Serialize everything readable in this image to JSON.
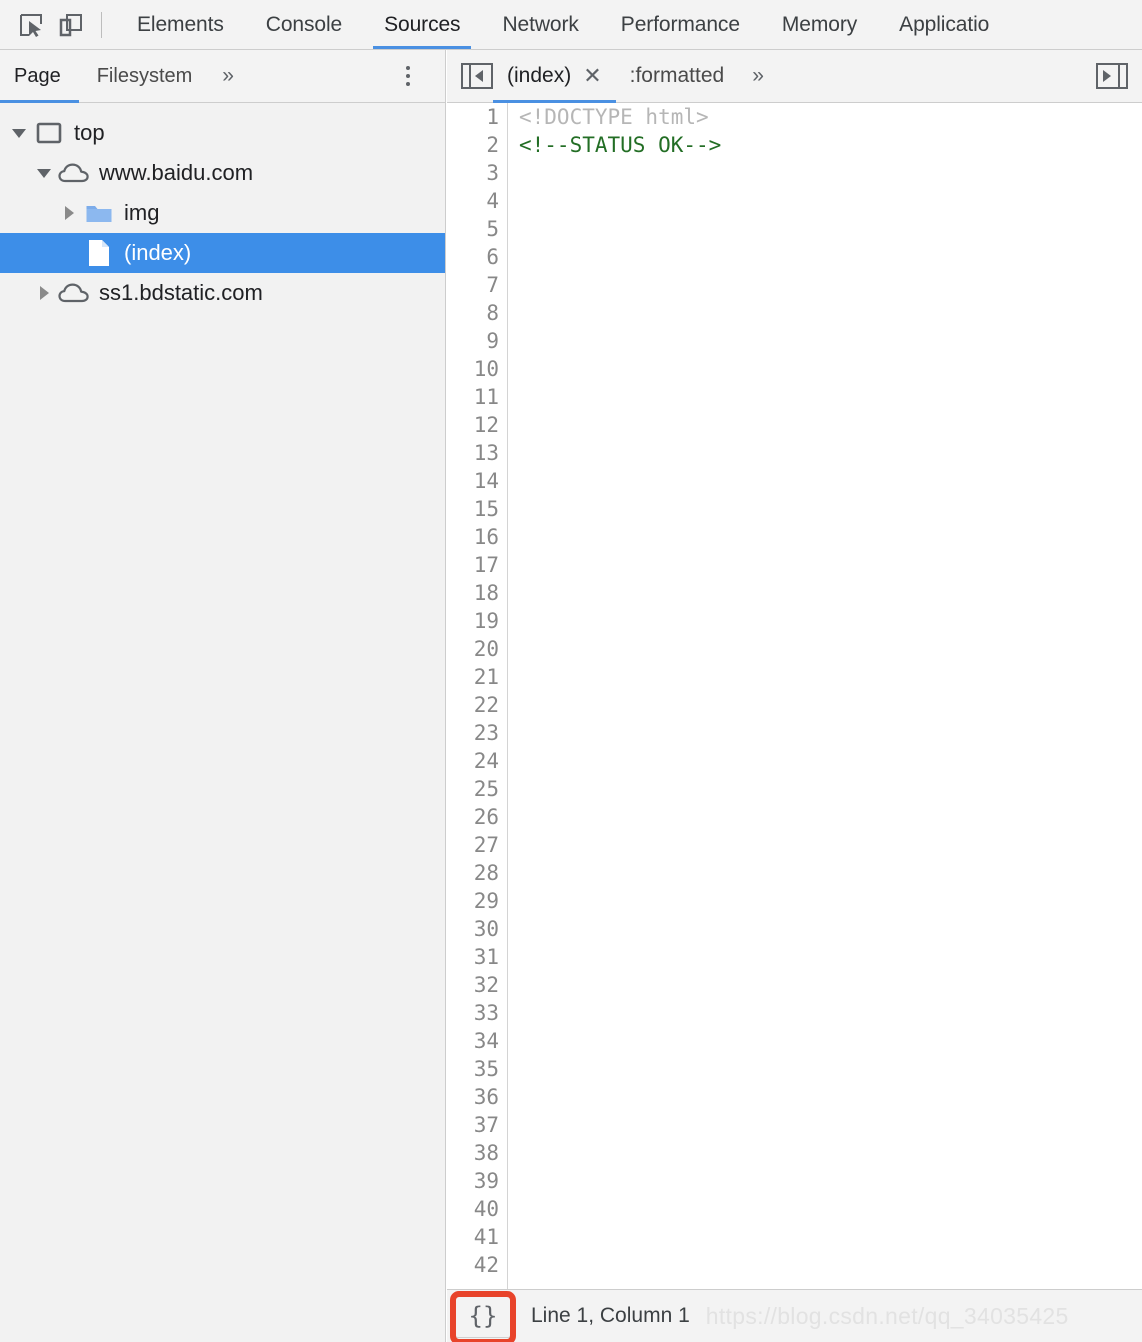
{
  "devtools": {
    "toolbar_icons": [
      {
        "name": "inspect-element-icon",
        "title": "Inspect element"
      },
      {
        "name": "device-toolbar-icon",
        "title": "Toggle device toolbar"
      }
    ],
    "panel_tabs": [
      {
        "label": "Elements",
        "active": false
      },
      {
        "label": "Console",
        "active": false
      },
      {
        "label": "Sources",
        "active": true
      },
      {
        "label": "Network",
        "active": false
      },
      {
        "label": "Performance",
        "active": false
      },
      {
        "label": "Memory",
        "active": false
      },
      {
        "label": "Applicatio",
        "active": false
      }
    ]
  },
  "navigator": {
    "tabs": [
      {
        "label": "Page",
        "active": true
      },
      {
        "label": "Filesystem",
        "active": false
      }
    ],
    "more_label": "»",
    "menu_icon": "kebab-menu-icon",
    "tree": [
      {
        "label": "top",
        "icon": "frame-icon",
        "twisty": "down",
        "depth": 0,
        "selected": false
      },
      {
        "label": "www.baidu.com",
        "icon": "cloud-icon",
        "twisty": "down",
        "depth": 1,
        "selected": false
      },
      {
        "label": "img",
        "icon": "folder-icon",
        "twisty": "right",
        "depth": 2,
        "selected": false
      },
      {
        "label": "(index)",
        "icon": "file-icon",
        "twisty": "none",
        "depth": 2,
        "selected": true
      },
      {
        "label": "ss1.bdstatic.com",
        "icon": "cloud-icon",
        "twisty": "right",
        "depth": 1,
        "selected": false
      }
    ]
  },
  "editor": {
    "toggle_navigator_icon": "collapse-navigator-icon",
    "tabs": [
      {
        "label": "(index)",
        "active": true,
        "closable": true,
        "close_glyph": "✕"
      },
      {
        "label": ":formatted",
        "active": false,
        "closable": false,
        "close_glyph": ""
      }
    ],
    "more_label": "»",
    "drawer_icon": "show-drawer-icon",
    "line_count": 42,
    "code": [
      {
        "line": 1,
        "text": "<!DOCTYPE html>",
        "token": "doctype"
      },
      {
        "line": 2,
        "text": "<!--STATUS OK-->",
        "token": "comment"
      }
    ]
  },
  "status": {
    "format_button_label": "{}",
    "cursor_position": "Line 1, Column 1",
    "watermark": "https://blog.csdn.net/qq_34035425"
  },
  "colors": {
    "accent_blue": "#4a90e2",
    "selection_blue": "#3d8ee8",
    "comment_green": "#236e25",
    "doctype_gray": "#b6b6b6",
    "highlight_red": "#e8432a",
    "chrome_gray": "#f3f3f3"
  }
}
